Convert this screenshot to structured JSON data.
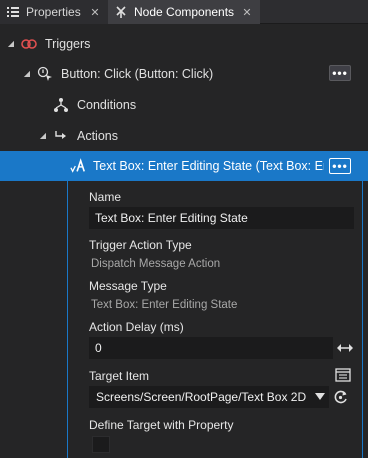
{
  "tabs": [
    {
      "label": "Properties",
      "icon": "list-icon",
      "close": "✕"
    },
    {
      "label": "Node Components",
      "icon": "node-components-icon",
      "close": "✕"
    }
  ],
  "tree": {
    "triggers": {
      "label": "Triggers",
      "icon": "trigger-icon"
    },
    "button_click": {
      "label": "Button: Click (Button: Click)",
      "icon": "click-icon",
      "menu": "•••"
    },
    "conditions": {
      "label": "Conditions",
      "icon": "conditions-icon"
    },
    "actions": {
      "label": "Actions",
      "icon": "actions-icon"
    },
    "selected_action": {
      "label": "Text Box: Enter Editing State (Text Box: Enter",
      "icon": "action-a-icon",
      "menu": "•••"
    }
  },
  "properties": {
    "name_label": "Name",
    "name_value": "Text Box: Enter Editing State",
    "trigger_action_type_label": "Trigger Action Type",
    "trigger_action_type_value": "Dispatch Message Action",
    "message_type_label": "Message Type",
    "message_type_value": "Text Box: Enter Editing State",
    "action_delay_label": "Action Delay (ms)",
    "action_delay_value": "0",
    "target_item_label": "Target Item",
    "target_item_value": "Screens/Screen/RootPage/Text Box 2D",
    "define_target_label": "Define Target with Property",
    "define_target_checked": false
  },
  "colors": {
    "selection": "#1a78c8",
    "background": "#252526",
    "field": "#1b1b1c",
    "trigger_icon": "#e05050"
  }
}
